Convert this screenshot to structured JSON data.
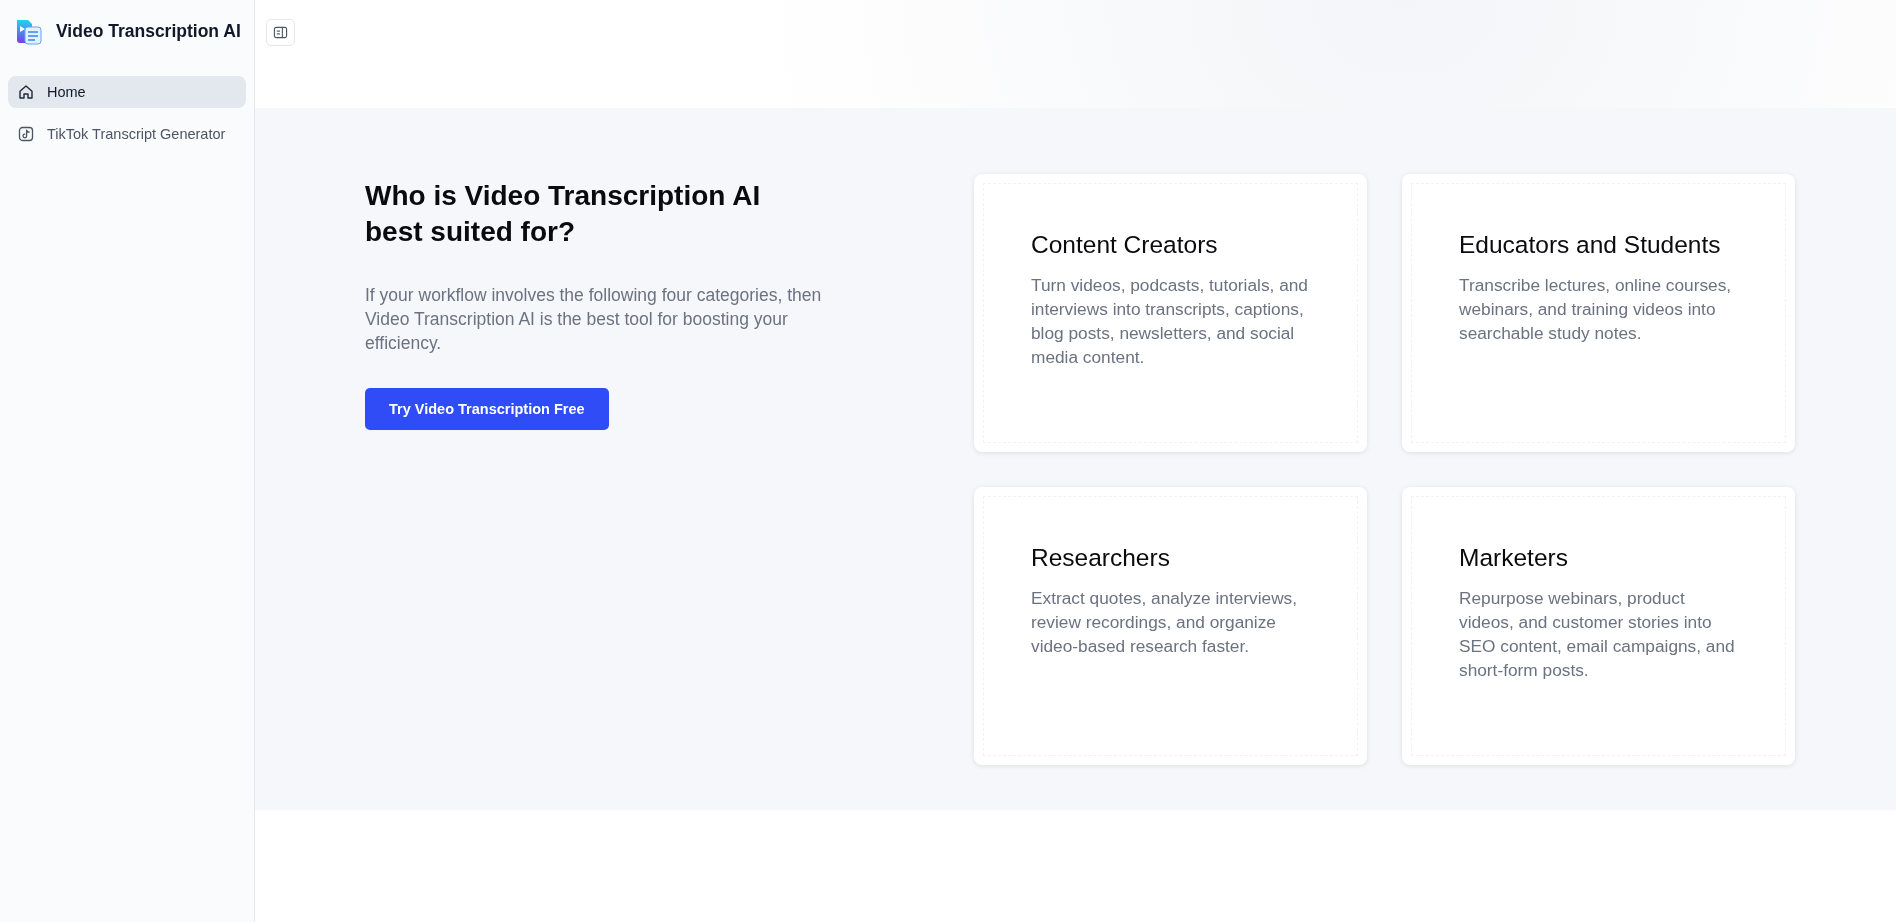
{
  "sidebar": {
    "app_name": "Video Transcription AI",
    "items": [
      {
        "label": "Home",
        "selected": true
      },
      {
        "label": "TikTok Transcript Generator",
        "selected": false
      }
    ]
  },
  "hero": {
    "heading": "Who is Video Transcription AI best suited for?",
    "description": "If your workflow involves the following four categories, then Video Transcription AI is the best tool for boosting your efficiency.",
    "button": "Try Video Transcription Free"
  },
  "cards": [
    {
      "title": "Content Creators",
      "description": "Turn videos, podcasts, tutorials, and interviews into transcripts, captions, blog posts, newsletters, and social media content."
    },
    {
      "title": "Educators and Students",
      "description": "Transcribe lectures, online courses, webinars, and training videos into searchable study notes."
    },
    {
      "title": "Researchers",
      "description": "Extract quotes, analyze interviews, review recordings, and organize video-based research faster."
    },
    {
      "title": "Marketers",
      "description": "Repurpose webinars, product videos, and customer stories into SEO content, email campaigns, and short-form posts."
    }
  ]
}
